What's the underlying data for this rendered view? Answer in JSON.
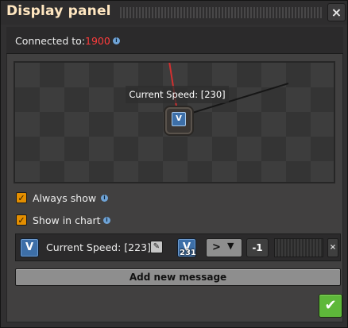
{
  "window": {
    "title": "Display panel",
    "close_label": "×"
  },
  "connection": {
    "label": "Connected to:",
    "value": "1900",
    "value_color": "#ff3c3c",
    "info_glyph": "i"
  },
  "preview": {
    "speed_text": "Current Speed: [230]",
    "entity_signal": "V"
  },
  "options": {
    "always_show": {
      "label": "Always show",
      "checked": true,
      "check_glyph": "✓"
    },
    "show_in_chart": {
      "label": "Show in chart",
      "checked": true,
      "check_glyph": "✓"
    },
    "info_glyph": "i"
  },
  "message": {
    "icon_signal": "V",
    "text": "Current Speed: [223]",
    "edit_glyph": "✎",
    "condition_signal": "V",
    "condition_signal_count": "231",
    "comparator": ">",
    "comparator_chevron": "▼",
    "constant": "-1",
    "remove_glyph": "×"
  },
  "add_message": {
    "label": "Add new message"
  },
  "confirm": {
    "glyph": "✔",
    "color": "#5eb83a"
  },
  "colors": {
    "accent_orange": "#e38e00",
    "signal_blue": "#3d6fa8",
    "title": "#ffe6c0"
  }
}
